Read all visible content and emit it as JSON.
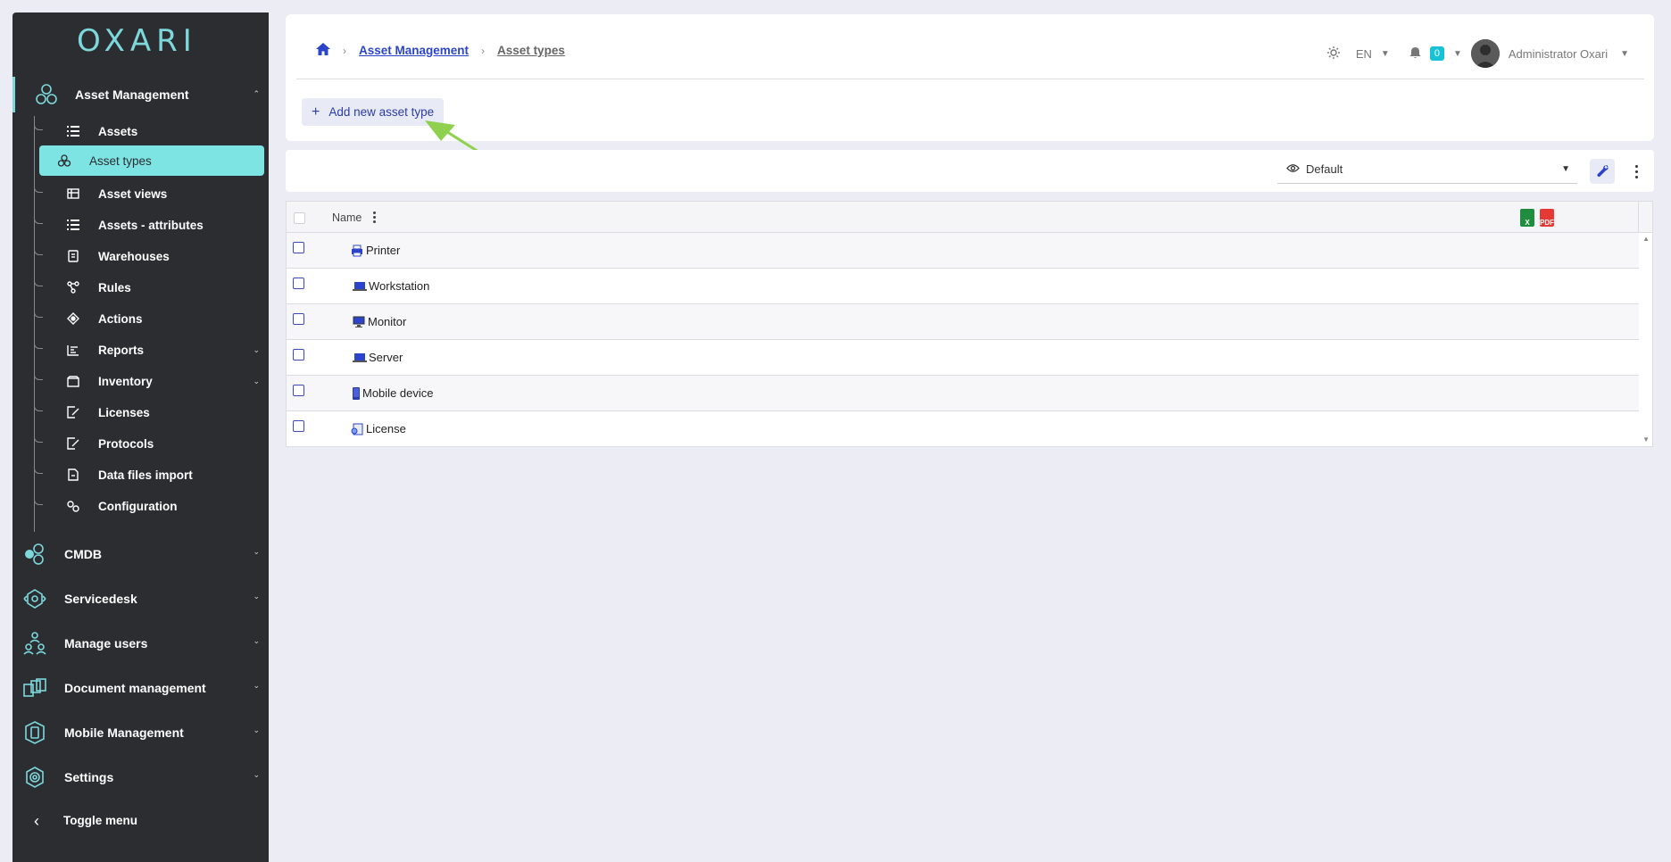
{
  "sidebar": {
    "logo": "OXARI",
    "active_section": "Asset Management",
    "asset_management_items": [
      {
        "label": "Assets",
        "icon": "list-icon"
      },
      {
        "label": "Asset types",
        "icon": "hexagon-cluster-icon"
      },
      {
        "label": "Asset views",
        "icon": "table-icon"
      },
      {
        "label": "Assets - attributes",
        "icon": "list-icon"
      },
      {
        "label": "Warehouses",
        "icon": "building-icon"
      },
      {
        "label": "Rules",
        "icon": "flow-icon"
      },
      {
        "label": "Actions",
        "icon": "target-icon"
      },
      {
        "label": "Reports",
        "icon": "chart-icon"
      },
      {
        "label": "Inventory",
        "icon": "box-icon"
      },
      {
        "label": "Licenses",
        "icon": "document-edit-icon"
      },
      {
        "label": "Protocols",
        "icon": "document-edit-icon"
      },
      {
        "label": "Data files import",
        "icon": "file-import-icon"
      },
      {
        "label": "Configuration",
        "icon": "gears-icon"
      }
    ],
    "sections": [
      {
        "label": "Asset Management",
        "icon": "hexagon-cluster-icon"
      },
      {
        "label": "CMDB",
        "icon": "cmdb-icon"
      },
      {
        "label": "Servicedesk",
        "icon": "servicedesk-icon"
      },
      {
        "label": "Manage users",
        "icon": "users-icon"
      },
      {
        "label": "Document management",
        "icon": "documents-icon"
      },
      {
        "label": "Mobile Management",
        "icon": "mobile-icon"
      },
      {
        "label": "Settings",
        "icon": "settings-icon"
      }
    ],
    "toggle_label": "Toggle menu"
  },
  "header": {
    "breadcrumb": [
      "Asset Management",
      "Asset types"
    ],
    "language": "EN",
    "notification_count": "0",
    "user_name": "Administrator Oxari"
  },
  "toolbar": {
    "add_label": "Add new asset type",
    "view_name": "Default"
  },
  "table": {
    "column_name": "Name",
    "export_xls": "X",
    "export_pdf": "PDF",
    "rows": [
      {
        "name": "Printer",
        "icon": "printer-icon"
      },
      {
        "name": "Workstation",
        "icon": "laptop-icon"
      },
      {
        "name": "Monitor",
        "icon": "monitor-icon"
      },
      {
        "name": "Server",
        "icon": "laptop-icon"
      },
      {
        "name": "Mobile device",
        "icon": "phone-icon"
      },
      {
        "name": "License",
        "icon": "license-icon"
      }
    ]
  },
  "colors": {
    "sidebar_bg": "#2b2d31",
    "accent": "#7ee3e3",
    "link": "#2b44c9",
    "badge": "#17c1d6",
    "annotation_arrow": "#8fd14f"
  }
}
